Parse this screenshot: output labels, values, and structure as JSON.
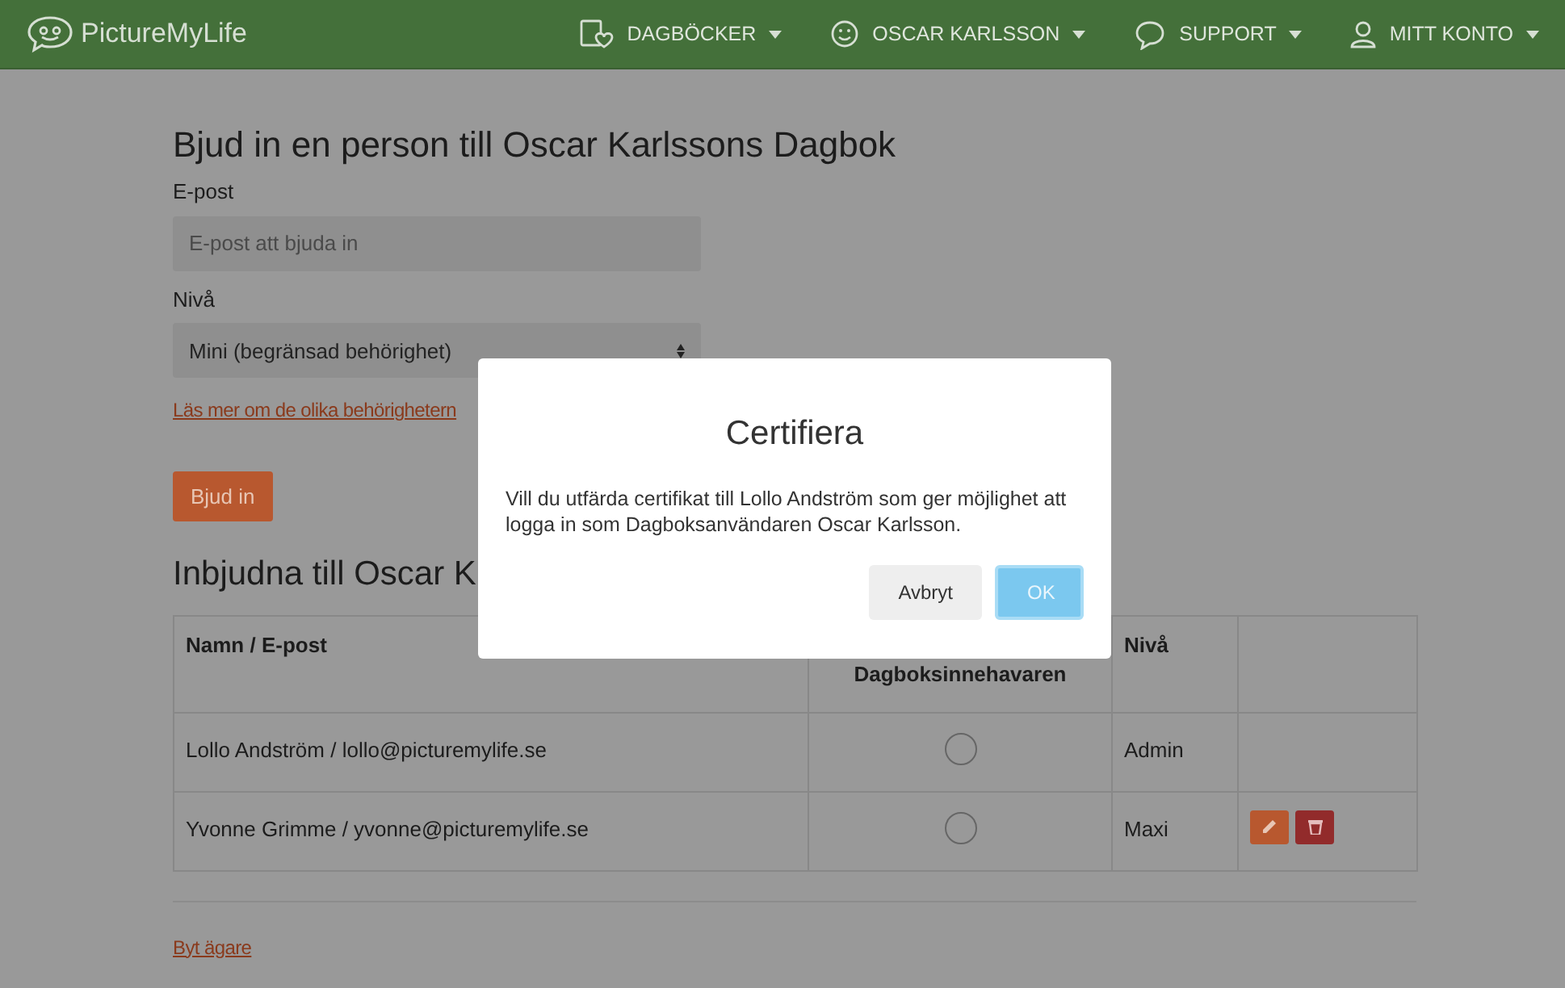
{
  "navbar": {
    "brand": "PictureMyLife",
    "items": [
      {
        "kind": "diary",
        "label": "DAGBÖCKER",
        "dropdown": true
      },
      {
        "kind": "face",
        "label": "OSCAR KARLSSON",
        "dropdown": true
      },
      {
        "kind": "chat",
        "label": "SUPPORT",
        "dropdown": true
      },
      {
        "kind": "user",
        "label": "MITT KONTO",
        "dropdown": true
      }
    ]
  },
  "invite_form": {
    "title": "Bjud in en person till Oscar Karlssons Dagbok",
    "email_label": "E-post",
    "email_placeholder": "E-post att bjuda in",
    "level_label": "Nivå",
    "level_value": "Mini (begränsad behörighet)",
    "info_link": "Läs mer om de olika behörighetern",
    "submit": "Bjud in"
  },
  "invited": {
    "title": "Inbjudna till Oscar K",
    "columns": [
      "Namn / E-post",
      "Dagboksinnehavaren",
      "Nivå"
    ],
    "rows": [
      {
        "name": "Lollo Andström / lollo@picturemylife.se",
        "checked": false,
        "level": "Admin",
        "actions": false
      },
      {
        "name": "Yvonne Grimme / yvonne@picturemylife.se",
        "checked": false,
        "level": "Maxi",
        "actions": true
      }
    ]
  },
  "owner_link": "Byt ägare",
  "modal": {
    "title": "Certifiera",
    "message": "Vill du utfärda certifikat till Lollo Andström som ger möjlighet att logga in som Dagboksanvändaren Oscar Karlsson.",
    "buttons": [
      {
        "label": "Avbryt",
        "kind": "cancel"
      },
      {
        "label": "OK",
        "kind": "primary"
      }
    ]
  }
}
